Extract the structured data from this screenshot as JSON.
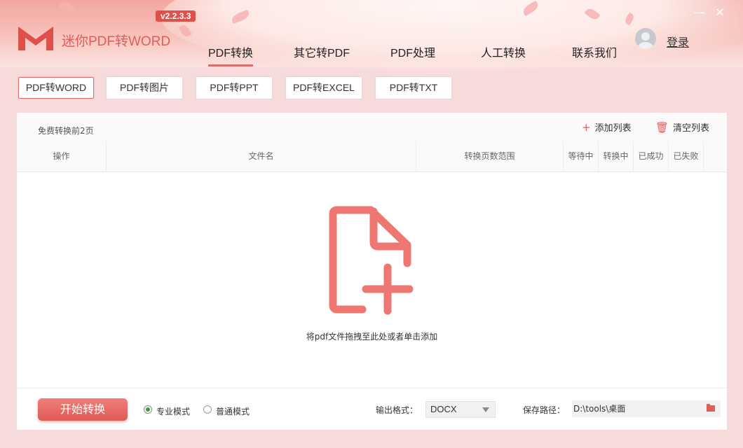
{
  "app": {
    "title": "迷你PDF转WORD",
    "version": "v2.2.3.3"
  },
  "window": {
    "minimize_label": "—",
    "close_label": "✕"
  },
  "nav": [
    {
      "label": "PDF转换",
      "active": true
    },
    {
      "label": "其它转PDF",
      "active": false
    },
    {
      "label": "PDF处理",
      "active": false
    },
    {
      "label": "人工转换",
      "active": false
    },
    {
      "label": "联系我们",
      "active": false
    }
  ],
  "user": {
    "login_label": "登录"
  },
  "subtabs": [
    {
      "label": "PDF转WORD",
      "active": true
    },
    {
      "label": "PDF转图片",
      "active": false
    },
    {
      "label": "PDF转PPT",
      "active": false
    },
    {
      "label": "PDF转EXCEL",
      "active": false
    },
    {
      "label": "PDF转TXT",
      "active": false
    }
  ],
  "toolbar": {
    "free_note": "免费转换前2页",
    "add_label": "添加列表",
    "add_icon": "plus-icon",
    "clear_label": "清空列表",
    "clear_icon": "trash-icon"
  },
  "table": {
    "columns": [
      "操作",
      "文件名",
      "转换页数范围",
      "等待中",
      "转换中",
      "已成功",
      "已失败"
    ]
  },
  "dropzone": {
    "hint": "将pdf文件拖拽至此处或者单击添加",
    "icon": "add-file-icon"
  },
  "footer": {
    "start_label": "开始转换",
    "modes": [
      {
        "label": "专业模式",
        "selected": true
      },
      {
        "label": "普通模式",
        "selected": false
      }
    ],
    "format_label": "输出格式：",
    "format_value": "DOCX",
    "path_label": "保存路径：",
    "path_value": "D:\\tools\\桌面"
  },
  "colors": {
    "accent": "#e05d58",
    "header_pink": "#f3a6a1",
    "background": "#f7dada"
  }
}
